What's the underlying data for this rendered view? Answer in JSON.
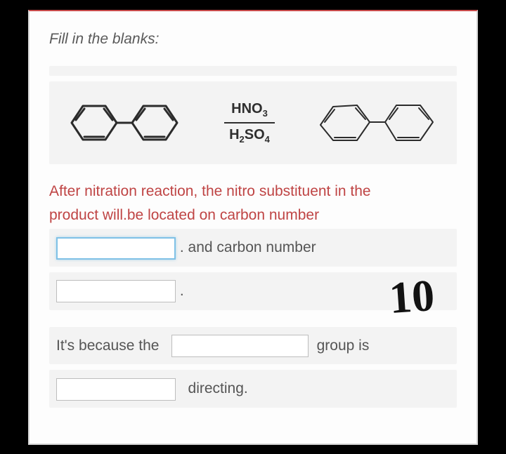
{
  "instruction": "Fill in the blanks:",
  "reagent_top": "HNO",
  "reagent_top_sub": "3",
  "reagent_bot": "H",
  "reagent_bot_sub1": "2",
  "reagent_bot_mid": "SO",
  "reagent_bot_sub2": "4",
  "q_line1": "After nitration reaction, the nitro substituent in the",
  "q_line2": "product will.be located on carbon number",
  "and_text": ". and carbon number",
  "dot": ".",
  "because_pre": "It's because the",
  "because_post": "group is",
  "directing": "directing.",
  "handwritten": "10"
}
